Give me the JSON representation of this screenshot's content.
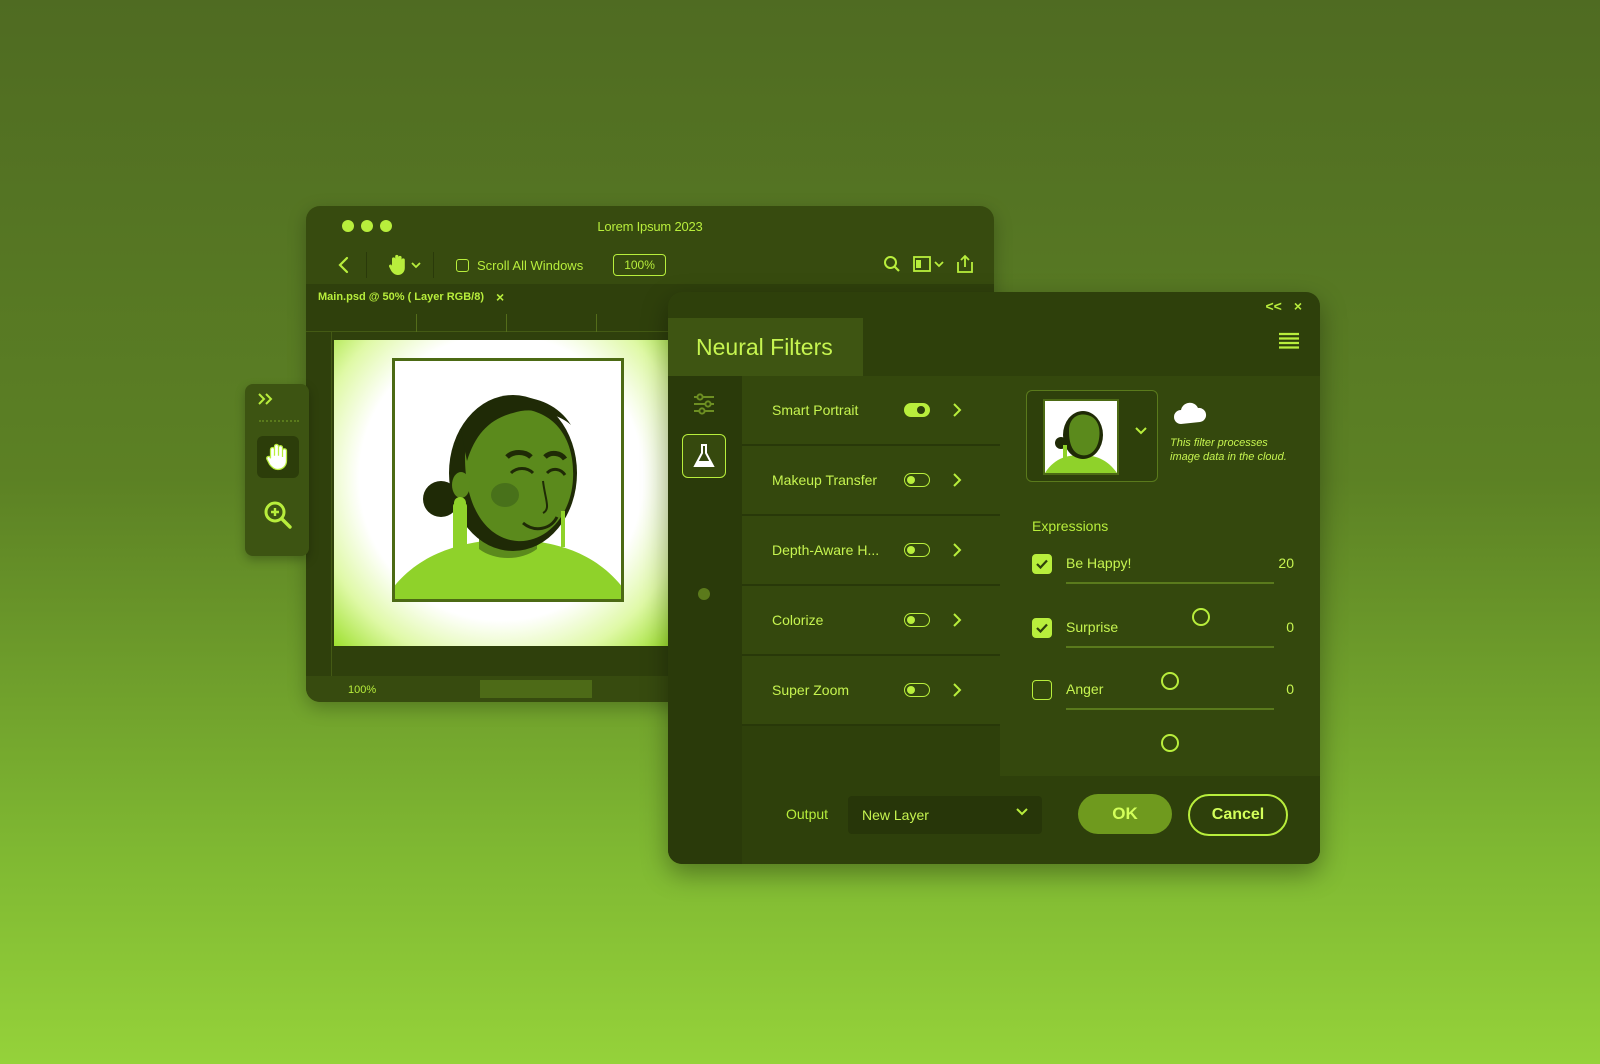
{
  "colors": {
    "accent": "#b8ee3c",
    "panel": "#2e400b",
    "background_top": "#4f6b22",
    "background_bottom": "#95d23a"
  },
  "app": {
    "title": "Lorem Ipsum 2023",
    "toolbar": {
      "scroll_all_label": "Scroll All Windows",
      "zoom": "100%"
    },
    "doc_tab": "Main.psd @ 50% ( Layer RGB/8)",
    "doc_tab_close": "×",
    "status_zoom": "100%"
  },
  "tools": {
    "expand_icon": "double-chevron-right",
    "items": [
      "hand-icon",
      "zoom-icon"
    ]
  },
  "dialog": {
    "title": "Neural Filters",
    "collapse": "<<",
    "close": "×",
    "filters": [
      {
        "label": "Smart Portrait",
        "enabled": true
      },
      {
        "label": "Makeup Transfer",
        "enabled": false
      },
      {
        "label": "Depth-Aware H...",
        "enabled": false
      },
      {
        "label": "Colorize",
        "enabled": false
      },
      {
        "label": "Super Zoom",
        "enabled": false
      }
    ],
    "cloud_note": "This filter processes image data in the cloud.",
    "expressions_title": "Expressions",
    "expressions": [
      {
        "label": "Be Happy!",
        "value": "20",
        "checked": true,
        "slider": 0.65
      },
      {
        "label": "Surprise",
        "value": "0",
        "checked": true,
        "slider": 0.5
      },
      {
        "label": "Anger",
        "value": "0",
        "checked": false,
        "slider": 0.5
      }
    ],
    "output_label": "Output",
    "output_value": "New Layer",
    "ok_label": "OK",
    "cancel_label": "Cancel"
  }
}
